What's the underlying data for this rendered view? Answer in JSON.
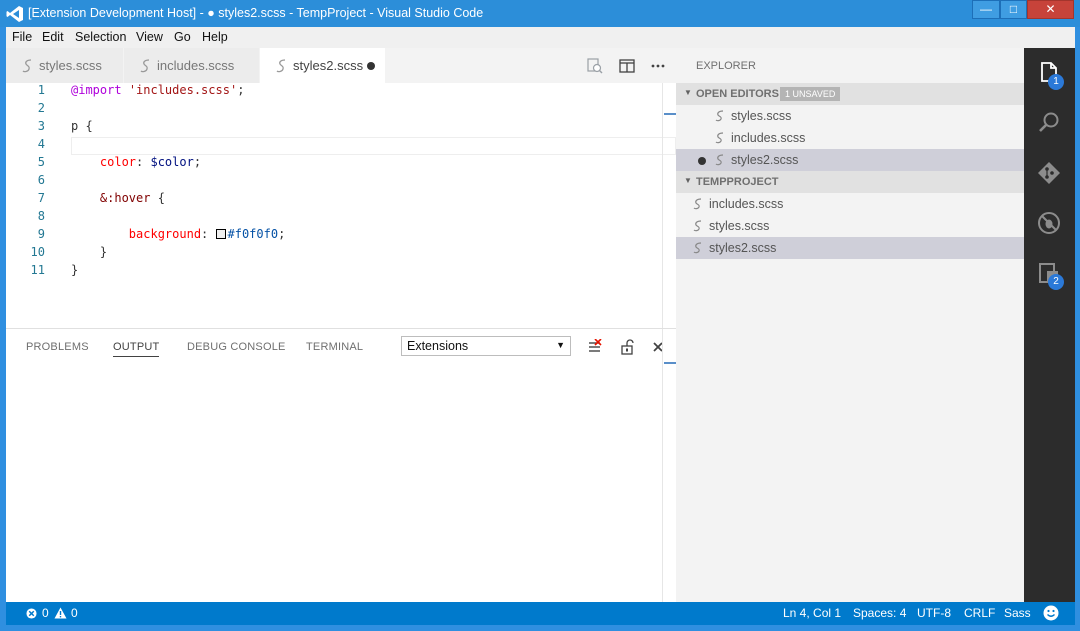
{
  "window": {
    "title": "[Extension Development Host] - ● styles2.scss - TempProject - Visual Studio Code",
    "controls": {
      "minimize": "—",
      "maximize": "□",
      "close": "✕"
    }
  },
  "menu": [
    "File",
    "Edit",
    "Selection",
    "View",
    "Go",
    "Help"
  ],
  "tabs": [
    {
      "label": "styles.scss",
      "active": false,
      "dirty": false
    },
    {
      "label": "includes.scss",
      "active": false,
      "dirty": false
    },
    {
      "label": "styles2.scss",
      "active": true,
      "dirty": true
    }
  ],
  "editor": {
    "line_numbers": [
      "1",
      "2",
      "3",
      "4",
      "5",
      "6",
      "7",
      "8",
      "9",
      "10",
      "11"
    ],
    "lines": {
      "l1": {
        "at": "@import",
        "sp": " ",
        "str": "'includes.scss'",
        "end": ";"
      },
      "l3": "p {",
      "l5": {
        "indent": "    ",
        "prop": "color",
        "colon": ": ",
        "var": "$color",
        "end": ";"
      },
      "l7": {
        "indent": "    ",
        "sel": "&:hover",
        "end": " {"
      },
      "l9": {
        "indent": "        ",
        "prop": "background",
        "colon": ": ",
        "hex": "#f0f0f0",
        "end": ";"
      },
      "l10": "    }",
      "l11": "}"
    },
    "swatch_color": "#f0f0f0"
  },
  "panel": {
    "tabs": [
      "PROBLEMS",
      "OUTPUT",
      "DEBUG CONSOLE",
      "TERMINAL"
    ],
    "active_tab": "OUTPUT",
    "select_value": "Extensions"
  },
  "explorer": {
    "title": "EXPLORER",
    "open_editors": {
      "label": "OPEN EDITORS",
      "badge": "1 UNSAVED",
      "files": [
        "styles.scss",
        "includes.scss",
        "styles2.scss"
      ]
    },
    "project": {
      "label": "TEMPPROJECT",
      "files": [
        "includes.scss",
        "styles.scss",
        "styles2.scss"
      ]
    }
  },
  "activity": {
    "explorer_badge": "1",
    "extensions_badge": "2"
  },
  "status": {
    "errors": "0",
    "warnings": "0",
    "position": "Ln 4, Col 1",
    "spaces": "Spaces: 4",
    "encoding": "UTF-8",
    "eol": "CRLF",
    "language": "Sass"
  },
  "colors": {
    "titlebar": "#2c8ed9",
    "statusbar": "#007acc",
    "activitybar": "#2c2c2c",
    "badge": "#2b79d8"
  },
  "icons": [
    "vscode-logo-icon",
    "sass-file-icon",
    "open-changes-icon",
    "split-editor-icon",
    "more-actions-icon",
    "clear-output-icon",
    "lock-icon",
    "close-panel-icon",
    "files-icon",
    "search-icon",
    "git-icon",
    "debug-icon",
    "extensions-icon",
    "error-icon",
    "warning-icon",
    "smiley-icon"
  ]
}
